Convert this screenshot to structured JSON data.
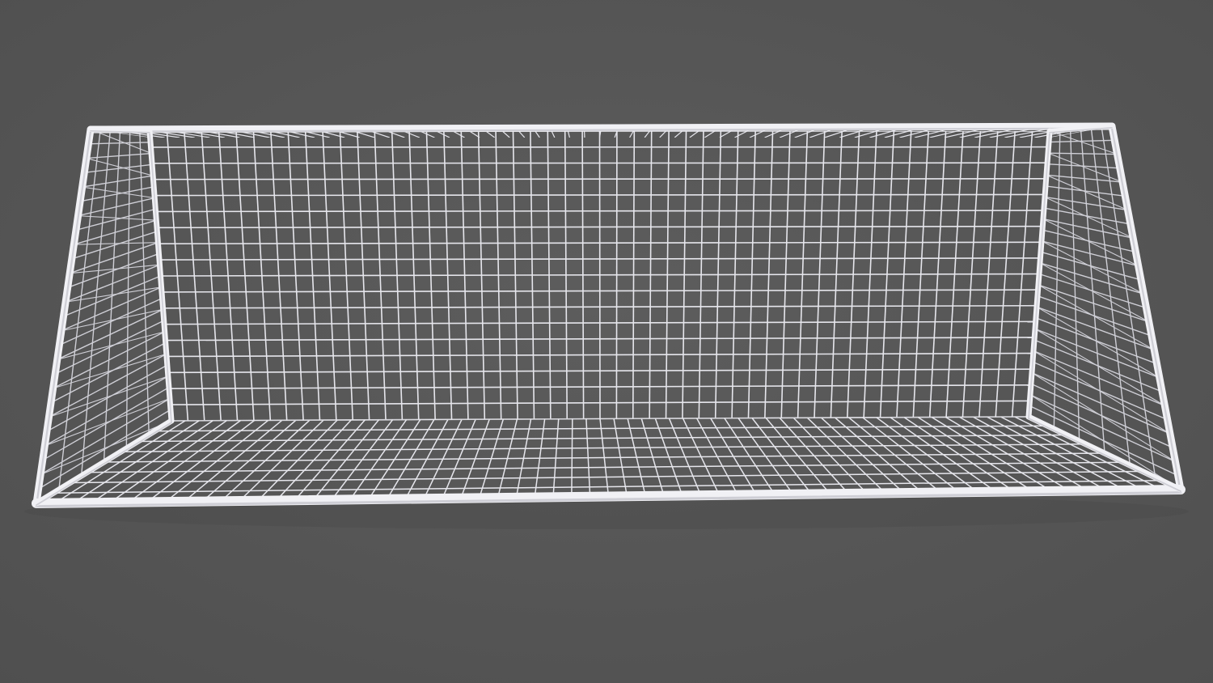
{
  "scene": {
    "subject": "goal-net-3d-render",
    "colors": {
      "background_center": "#5d5d5d",
      "background_edge": "#4f4f4f",
      "net_mesh": "#e6e6ec",
      "net_mesh_dim": "#cfcfd6",
      "frame_tube": "#f1f1f5",
      "frame_shadow": "#b8b8c0",
      "floor_shadow": "#474747"
    }
  }
}
